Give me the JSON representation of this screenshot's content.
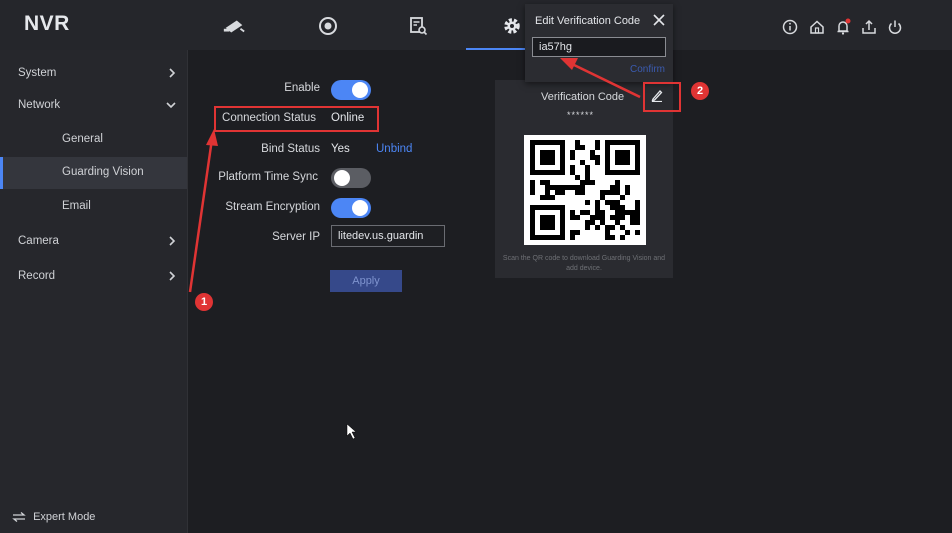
{
  "topbar": {
    "logo": "NVR",
    "accent": "#4c86f5"
  },
  "sidebar": {
    "items": [
      {
        "label": "System",
        "chevron": "chevron-right-icon"
      },
      {
        "label": "Network",
        "chevron": "chevron-down-icon"
      },
      {
        "label": "General"
      },
      {
        "label": "Guarding Vision",
        "active": true
      },
      {
        "label": "Email"
      },
      {
        "label": "Camera",
        "chevron": "chevron-right-icon"
      },
      {
        "label": "Record",
        "chevron": "chevron-right-icon"
      }
    ],
    "expert_mode": "Expert Mode"
  },
  "form": {
    "enable_label": "Enable",
    "enable_on": true,
    "connection_status_label": "Connection Status",
    "connection_status_value": "Online",
    "bind_status_label": "Bind Status",
    "bind_status_value": "Yes",
    "unbind_link": "Unbind",
    "platform_time_sync_label": "Platform Time Sync",
    "platform_time_sync_on": false,
    "stream_encryption_label": "Stream Encryption",
    "stream_encryption_on": true,
    "server_ip_label": "Server IP",
    "server_ip_value": "litedev.us.guardin",
    "apply_label": "Apply"
  },
  "qr_panel": {
    "title": "Verification Code",
    "masked_code": "******",
    "hint": "Scan the QR code to download Guarding Vision and add device."
  },
  "popup": {
    "title": "Edit Verification Code",
    "input_value": "ia57hg",
    "confirm_label": "Confirm"
  },
  "annotations": {
    "badge_1": "1",
    "badge_2": "2",
    "color": "#e03434"
  }
}
